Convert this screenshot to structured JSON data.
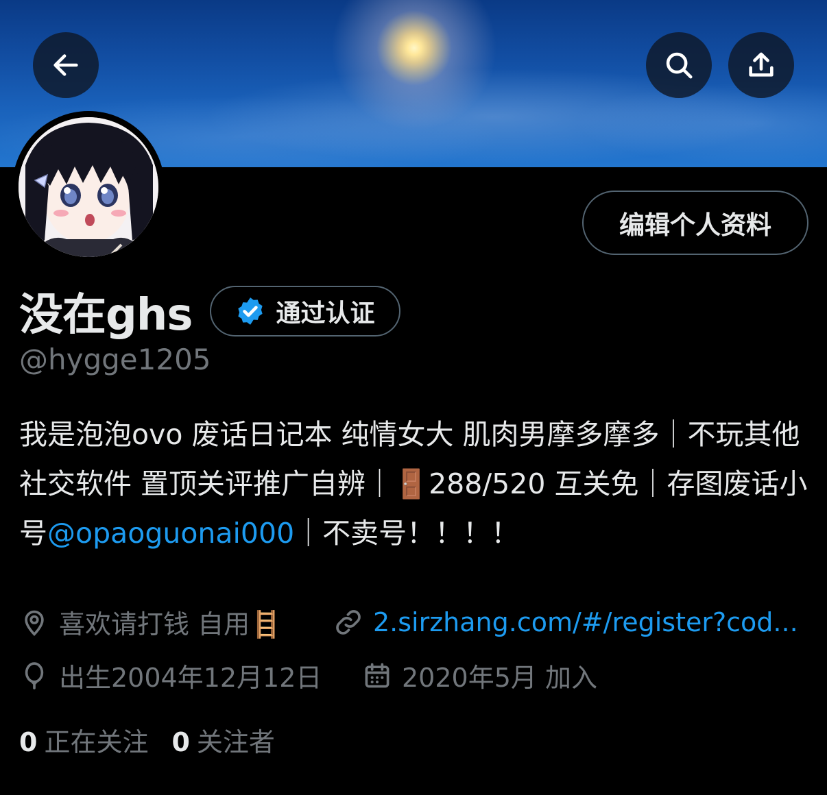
{
  "header": {
    "back_icon": "arrow-left-icon",
    "search_icon": "search-icon",
    "share_icon": "share-upload-icon"
  },
  "profile": {
    "display_name": "没在ghs",
    "verified_label": "通过认证",
    "handle": "@hygge1205",
    "edit_button": "编辑个人资料",
    "bio_before": "我是泡泡ovo 废话日记本 纯情女大 肌肉男摩多摩多｜不玩其他社交软件 置顶关评推广自辨｜🚪288/520 互关免｜存图废话小号",
    "bio_mention": "@opaoguonai000",
    "bio_after": "｜不卖号！！！！",
    "location": "喜欢请打钱 自用🪜",
    "website": "2.sirzhang.com/#/register?cod...",
    "birthday": "出生2004年12月12日",
    "joined": "2020年5月 加入"
  },
  "stats": {
    "following_count": "0",
    "following_label": "正在关注",
    "followers_count": "0",
    "followers_label": "关注者"
  },
  "colors": {
    "accent": "#1d9bf0",
    "muted": "#71767b",
    "text": "#e7e9ea",
    "background": "#000000"
  }
}
